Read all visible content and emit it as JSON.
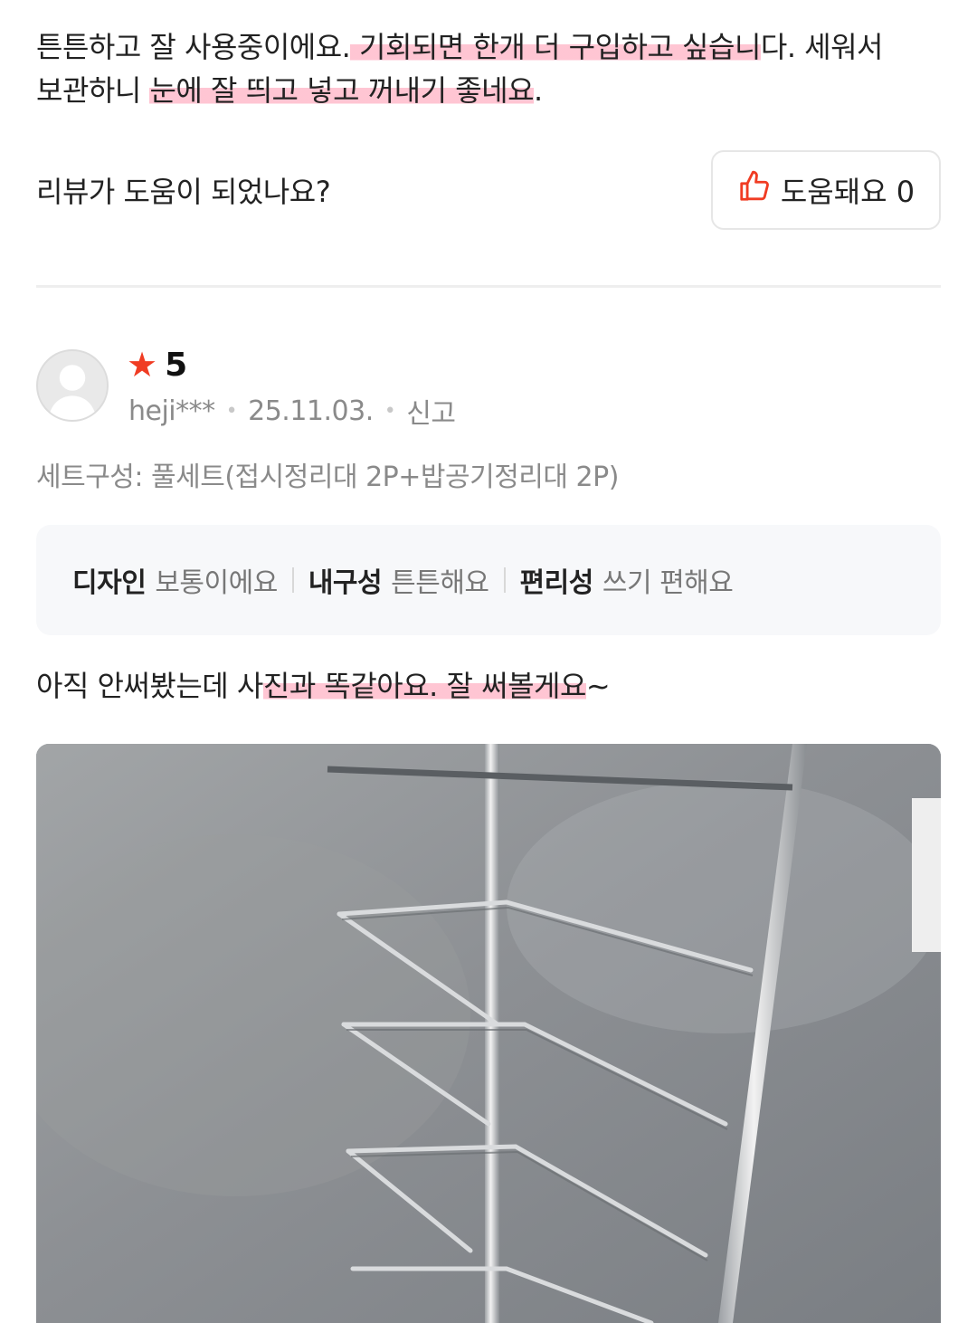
{
  "previous_review": {
    "text_plain_1": "튼튼하고 잘 사용중이에요.",
    "text_highlight_1": " 기회되면 한개 더 구입하고 싶습니",
    "text_plain_2": "다. 세워서",
    "text_plain_3": "보관하니 ",
    "text_highlight_2": "눈에 잘 띄고 넣고 꺼내기 좋네요",
    "text_plain_4": ".",
    "helpful_question": "리뷰가 도움이 되었나요?",
    "helpful_button_label": "도움돼요 0",
    "colors": {
      "highlight": "#ff96af",
      "thumb_icon": "#f03c23"
    }
  },
  "review": {
    "rating": "5",
    "star_color": "#f03c23",
    "user_id": "heji***",
    "date": "25.11.03.",
    "report_label": "신고",
    "option_text": "세트구성: 풀세트(접시정리대 2P+밥공기정리대 2P)",
    "attributes": [
      {
        "label": "디자인",
        "value": "보통이에요"
      },
      {
        "label": "내구성",
        "value": "튼튼해요"
      },
      {
        "label": "편리성",
        "value": "쓰기 편해요"
      }
    ],
    "text_plain_1": "아직 안써봤는데 사",
    "text_highlight": "진과 똑같아요. 잘 써볼게요",
    "text_plain_2": "~",
    "photo_icon": "stainless-dish-rack-photo"
  }
}
